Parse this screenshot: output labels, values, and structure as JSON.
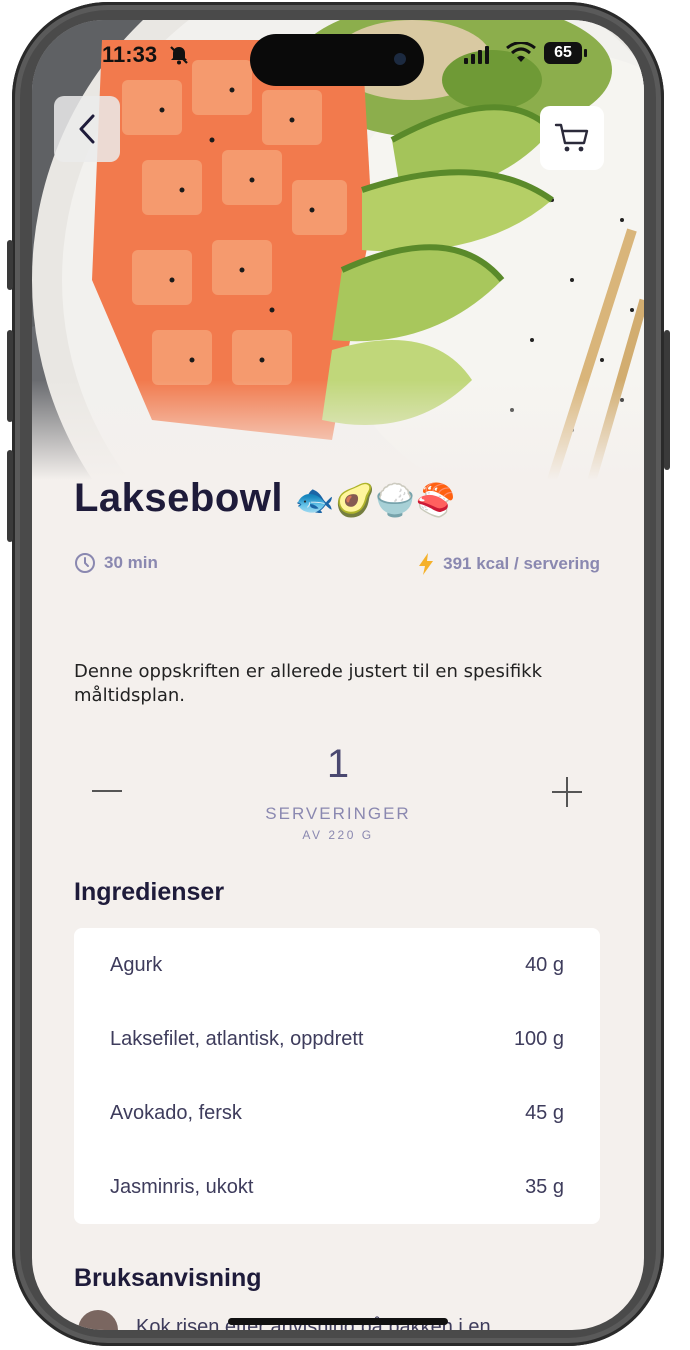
{
  "status_bar": {
    "time": "11:33",
    "battery": "65"
  },
  "recipe": {
    "title": "Laksebowl",
    "emoji": "🐟🥑🍚🍣",
    "time": "30 min",
    "kcal": "391 kcal / servering",
    "description": "Denne oppskriften er allerede justert til en spesifikk måltidsplan."
  },
  "servings": {
    "count": "1",
    "label": "SERVERINGER",
    "sublabel": "AV 220 G"
  },
  "ingredients": {
    "title": "Ingredienser",
    "items": [
      {
        "name": "Agurk",
        "amount": "40 g"
      },
      {
        "name": "Laksefilet, atlantisk, oppdrett",
        "amount": "100 g"
      },
      {
        "name": "Avokado, fersk",
        "amount": "45 g"
      },
      {
        "name": "Jasminris, ukokt",
        "amount": "35 g"
      }
    ]
  },
  "instructions": {
    "title": "Bruksanvisning",
    "first_step": "Kok risen etter anvisning på pakken i en"
  },
  "icons": {
    "back": "chevron-left-icon",
    "cart": "cart-icon",
    "clock": "clock-icon",
    "bolt": "bolt-icon",
    "bell_muted": "bell-slash-icon"
  },
  "colors": {
    "background": "#f4f0ed",
    "title": "#1e1b3a",
    "muted": "#8a88b0",
    "bolt": "#f5b12a"
  }
}
